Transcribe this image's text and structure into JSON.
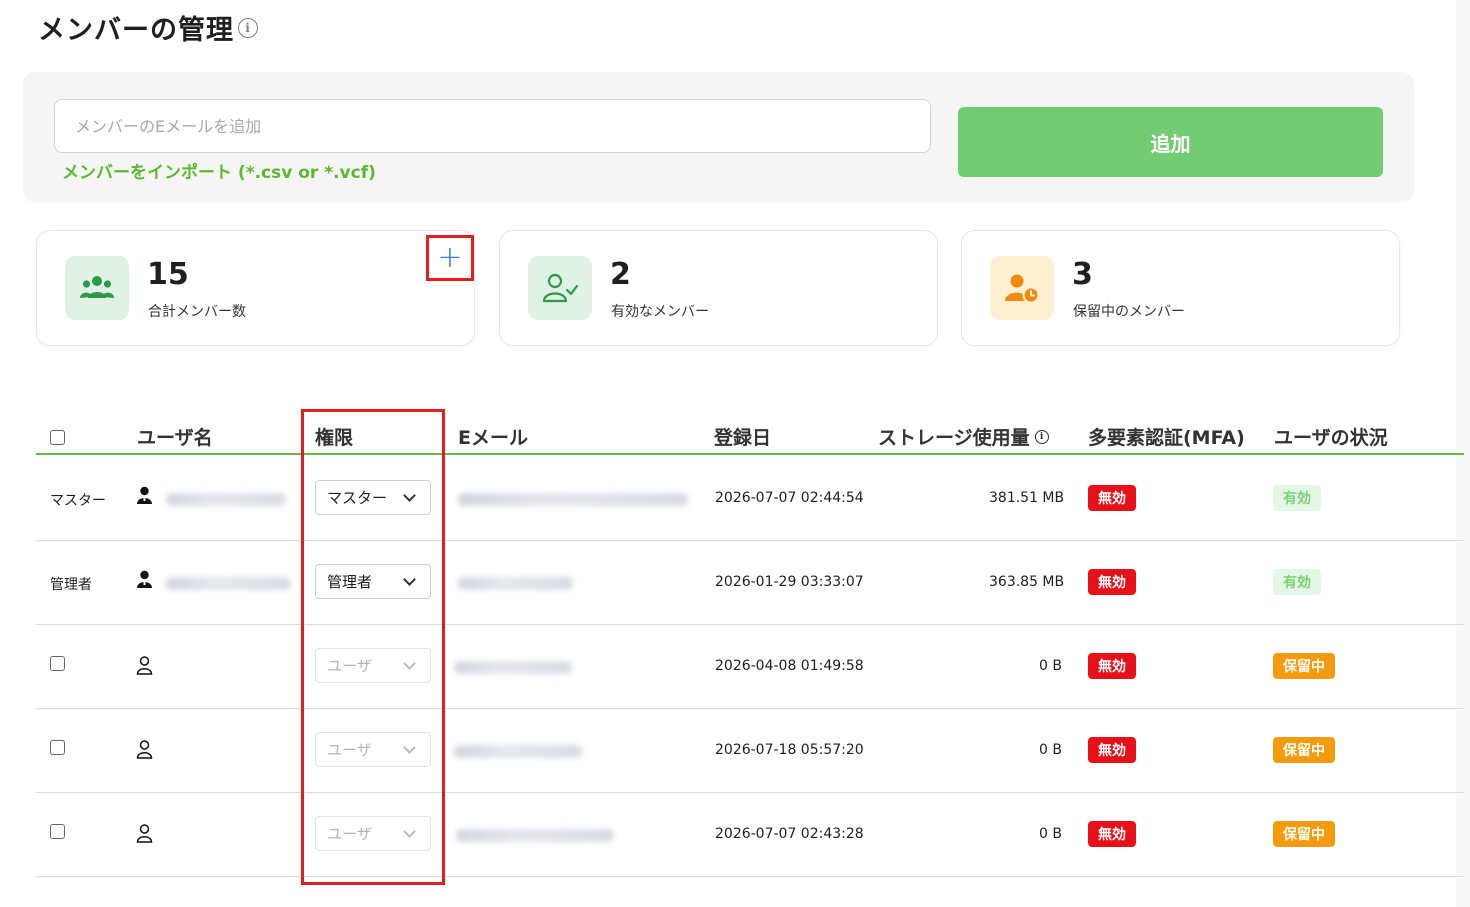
{
  "page": {
    "title": "メンバーの管理",
    "info_icon": "info-icon"
  },
  "add_member": {
    "email_placeholder": "メンバーのEメールを追加",
    "email_value": "",
    "import_link": "メンバーをインポート (*.csv or *.vcf)",
    "add_button": "追加"
  },
  "stats": [
    {
      "number": "15",
      "label": "合計メンバー数",
      "icon": "users-group-icon",
      "icon_bg": "#dff2e3",
      "icon_color": "#2e9a48"
    },
    {
      "number": "2",
      "label": "有効なメンバー",
      "icon": "user-check-icon",
      "icon_bg": "#dff2e3",
      "icon_color": "#2e9a48"
    },
    {
      "number": "3",
      "label": "保留中のメンバー",
      "icon": "user-clock-icon",
      "icon_bg": "#fdefd2",
      "icon_color": "#f08a0c"
    }
  ],
  "add_stat_button": "+",
  "table": {
    "headers": {
      "username": "ユーザ名",
      "role": "権限",
      "email": "Eメール",
      "registered": "登録日",
      "storage": "ストレージ使用量",
      "mfa": "多要素認証(MFA)",
      "status": "ユーザの状況"
    },
    "rows": [
      {
        "role_label": "マスター",
        "role_value": "マスター",
        "select_enabled": true,
        "date": "2026-07-07 02:44:54",
        "storage": "381.51 MB",
        "mfa": "無効",
        "status": "有効",
        "status_type": "green"
      },
      {
        "role_label": "管理者",
        "role_value": "管理者",
        "select_enabled": true,
        "date": "2026-01-29 03:33:07",
        "storage": "363.85 MB",
        "mfa": "無効",
        "status": "有効",
        "status_type": "green"
      },
      {
        "role_label": "",
        "role_value": "ユーザ",
        "select_enabled": false,
        "date": "2026-04-08 01:49:58",
        "storage": "0 B",
        "mfa": "無効",
        "status": "保留中",
        "status_type": "orange"
      },
      {
        "role_label": "",
        "role_value": "ユーザ",
        "select_enabled": false,
        "date": "2026-07-18 05:57:20",
        "storage": "0 B",
        "mfa": "無効",
        "status": "保留中",
        "status_type": "orange"
      },
      {
        "role_label": "",
        "role_value": "ユーザ",
        "select_enabled": false,
        "date": "2026-07-07 02:43:28",
        "storage": "0 B",
        "mfa": "無効",
        "status": "保留中",
        "status_type": "orange"
      }
    ]
  },
  "colors": {
    "accent_green": "#73cb73",
    "link_green": "#5cb82f",
    "highlight_red": "#e02020",
    "badge_red": "#e8111a",
    "badge_orange": "#f59b0b"
  }
}
